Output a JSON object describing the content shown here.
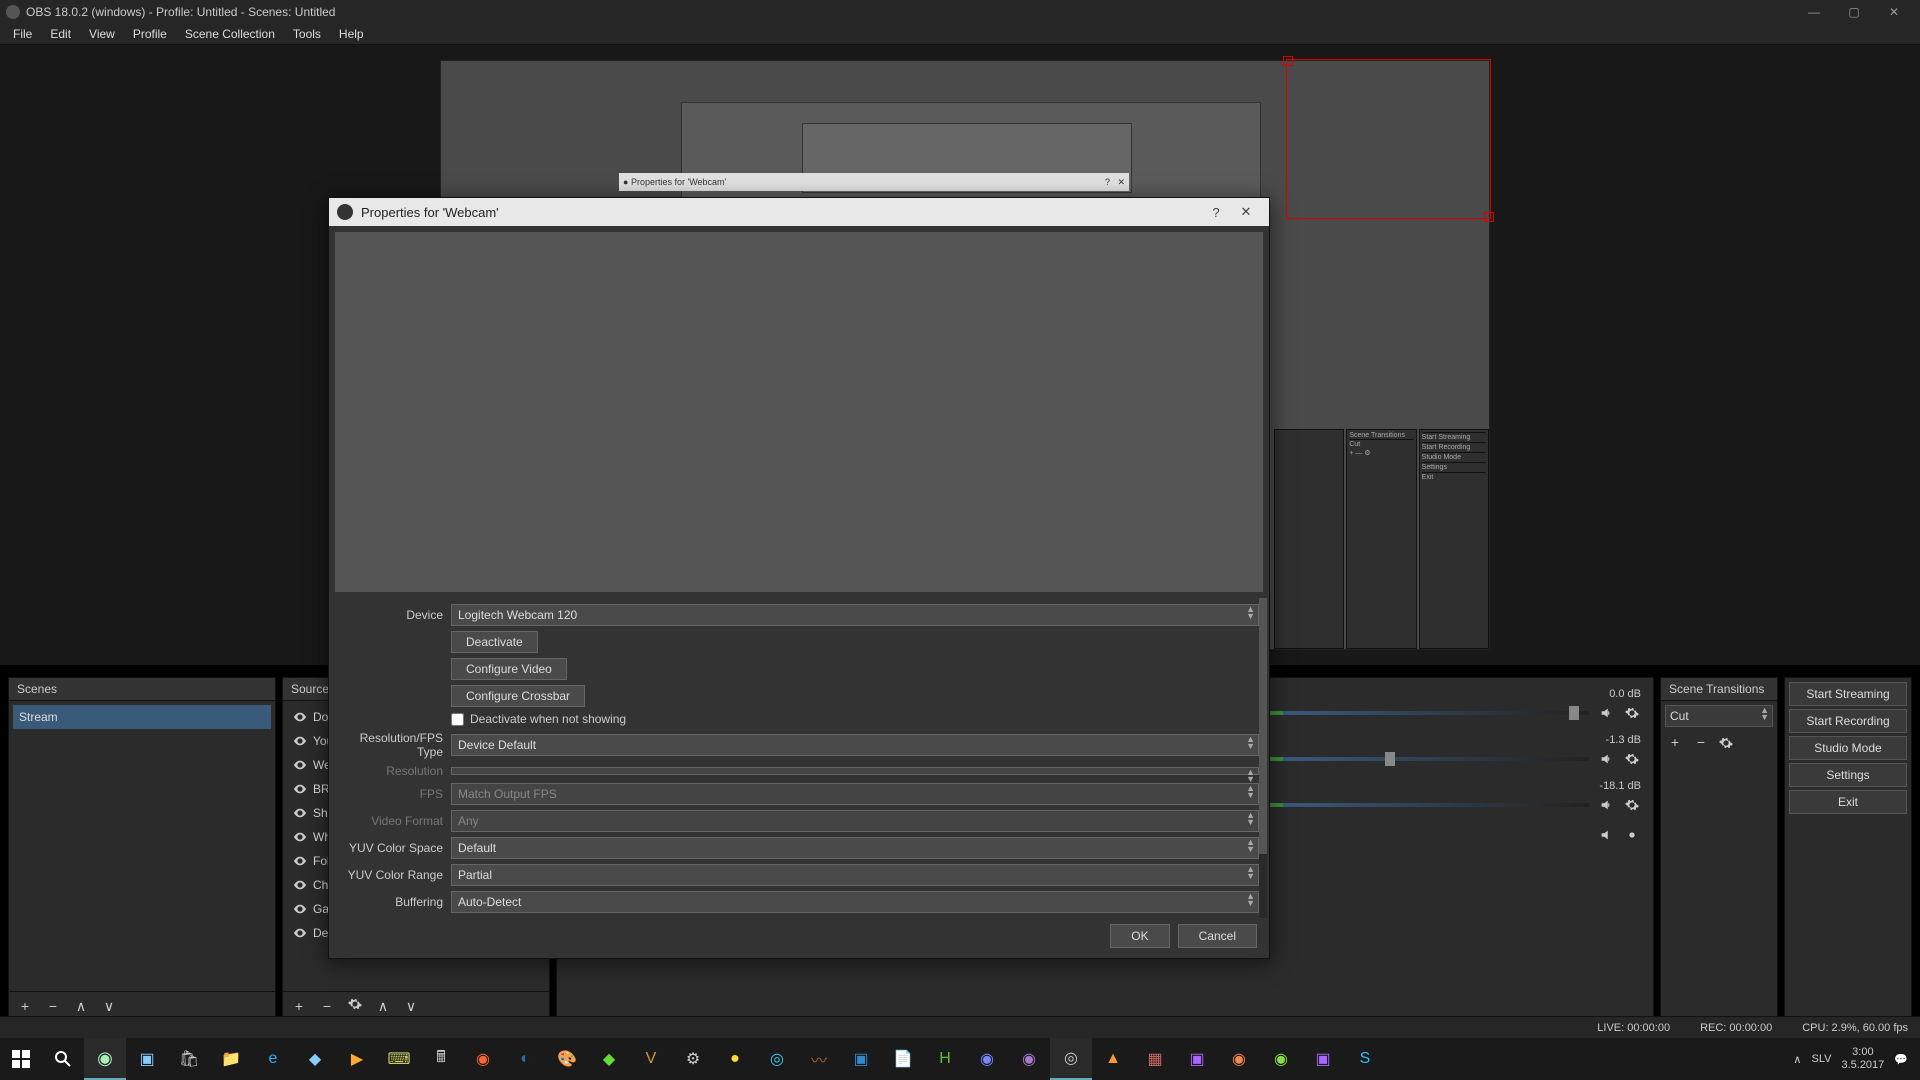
{
  "window": {
    "title": "OBS 18.0.2 (windows) - Profile: Untitled - Scenes: Untitled"
  },
  "menu": {
    "items": [
      "File",
      "Edit",
      "View",
      "Profile",
      "Scene Collection",
      "Tools",
      "Help"
    ]
  },
  "dialog": {
    "title": "Properties for 'Webcam'",
    "labels": {
      "device": "Device",
      "resfpstype": "Resolution/FPS Type",
      "resolution": "Resolution",
      "fps": "FPS",
      "videoformat": "Video Format",
      "yuvspace": "YUV Color Space",
      "yuvrange": "YUV Color Range",
      "buffering": "Buffering"
    },
    "values": {
      "device": "Logitech Webcam 120",
      "resfpstype": "Device Default",
      "resolution": "",
      "fps": "Match Output FPS",
      "videoformat": "Any",
      "yuvspace": "Default",
      "yuvrange": "Partial",
      "buffering": "Auto-Detect"
    },
    "buttons": {
      "deactivate": "Deactivate",
      "configVideo": "Configure Video",
      "configCrossbar": "Configure Crossbar",
      "deactivateCheck": "Deactivate when not showing",
      "ok": "OK",
      "cancel": "Cancel"
    },
    "nested_title": "Properties for 'Webcam'"
  },
  "panels": {
    "scenes": {
      "title": "Scenes",
      "items": [
        "Stream"
      ]
    },
    "sources": {
      "title": "Sources",
      "items": [
        "Don",
        "You",
        "Wel",
        "BRE",
        "She",
        "Whe",
        "Foll",
        "Cha",
        "Gan",
        "Des"
      ]
    },
    "transitions": {
      "title": "Scene Transitions",
      "value": "Cut"
    },
    "mixer": {
      "channels": [
        {
          "db": "0.0 dB",
          "handle": 98
        },
        {
          "db": "-1.3 dB",
          "handle": 80
        },
        {
          "db": "-18.1 dB",
          "handle": 50
        }
      ]
    },
    "controls": {
      "buttons": [
        "Start Streaming",
        "Start Recording",
        "Studio Mode",
        "Settings",
        "Exit"
      ]
    }
  },
  "status": {
    "live": "LIVE: 00:00:00",
    "rec": "REC: 00:00:00",
    "cpu": "CPU: 2.9%, 60.00 fps"
  },
  "taskbar": {
    "tray": {
      "lang": "SLV",
      "time": "3:00",
      "date": "3.5.2017"
    }
  }
}
